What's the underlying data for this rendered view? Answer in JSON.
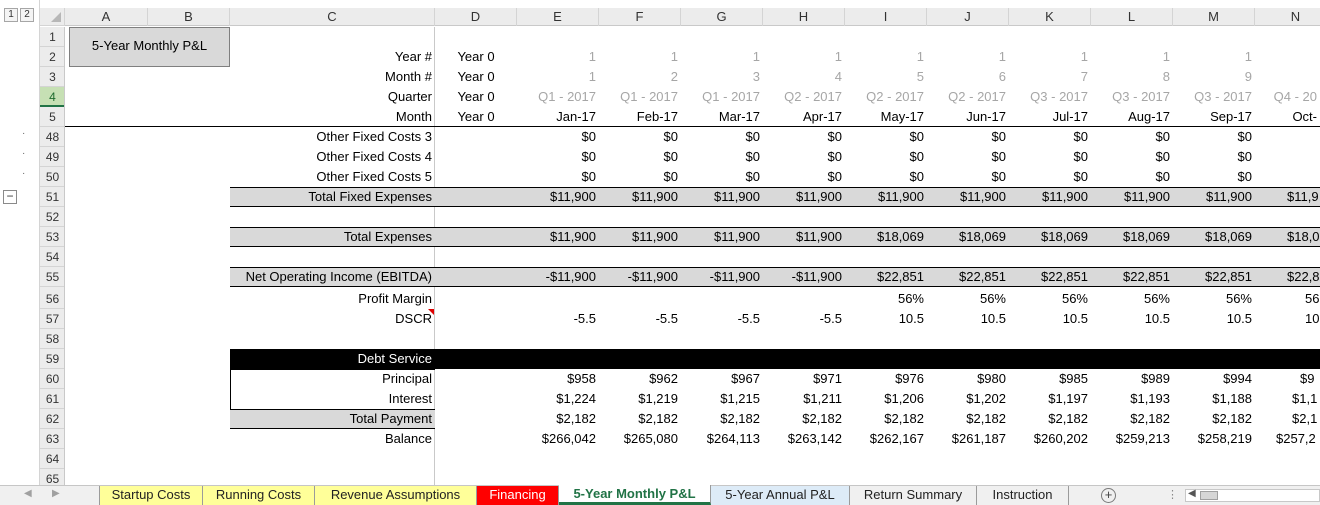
{
  "outline": {
    "levels": [
      "1",
      "2"
    ],
    "collapse_symbol": "−",
    "dot": "·"
  },
  "columns": [
    "A",
    "B",
    "C",
    "D",
    "E",
    "F",
    "G",
    "H",
    "I",
    "J",
    "K",
    "L",
    "M",
    "N"
  ],
  "rows": [
    "1",
    "2",
    "3",
    "4",
    "5",
    "48",
    "49",
    "50",
    "51",
    "52",
    "53",
    "54",
    "55",
    "56",
    "57",
    "58",
    "59",
    "60",
    "61",
    "62",
    "63",
    "64",
    "65"
  ],
  "title_box": "5-Year Monthly P&L",
  "header": {
    "year_label": "Year #",
    "month_label": "Month #",
    "quarter_label": "Quarter",
    "month_name_label": "Month",
    "d_value": "Year 0",
    "years": [
      "1",
      "1",
      "1",
      "1",
      "1",
      "1",
      "1",
      "1",
      "1",
      ""
    ],
    "month_nums": [
      "1",
      "2",
      "3",
      "4",
      "5",
      "6",
      "7",
      "8",
      "9",
      ""
    ],
    "quarters": [
      "Q1 - 2017",
      "Q1 - 2017",
      "Q1 - 2017",
      "Q2 - 2017",
      "Q2 - 2017",
      "Q2 - 2017",
      "Q3 - 2017",
      "Q3 - 2017",
      "Q3 - 2017",
      "Q4 - 20"
    ],
    "months": [
      "Jan-17",
      "Feb-17",
      "Mar-17",
      "Apr-17",
      "May-17",
      "Jun-17",
      "Jul-17",
      "Aug-17",
      "Sep-17",
      "Oct-"
    ]
  },
  "body": {
    "other_fixed_3": {
      "label": "Other Fixed Costs 3",
      "values": [
        "$0",
        "$0",
        "$0",
        "$0",
        "$0",
        "$0",
        "$0",
        "$0",
        "$0",
        ""
      ]
    },
    "other_fixed_4": {
      "label": "Other Fixed Costs 4",
      "values": [
        "$0",
        "$0",
        "$0",
        "$0",
        "$0",
        "$0",
        "$0",
        "$0",
        "$0",
        ""
      ]
    },
    "other_fixed_5": {
      "label": "Other Fixed Costs 5",
      "values": [
        "$0",
        "$0",
        "$0",
        "$0",
        "$0",
        "$0",
        "$0",
        "$0",
        "$0",
        ""
      ]
    },
    "total_fixed": {
      "label": "Total Fixed Expenses",
      "values": [
        "$11,900",
        "$11,900",
        "$11,900",
        "$11,900",
        "$11,900",
        "$11,900",
        "$11,900",
        "$11,900",
        "$11,900",
        "$11,9"
      ]
    },
    "total_expenses": {
      "label": "Total Expenses",
      "values": [
        "$11,900",
        "$11,900",
        "$11,900",
        "$11,900",
        "$18,069",
        "$18,069",
        "$18,069",
        "$18,069",
        "$18,069",
        "$18,0"
      ]
    },
    "noi": {
      "label": "Net Operating Income (EBITDA)",
      "values": [
        "-$11,900",
        "-$11,900",
        "-$11,900",
        "-$11,900",
        "$22,851",
        "$22,851",
        "$22,851",
        "$22,851",
        "$22,851",
        "$22,8"
      ]
    },
    "profit_margin": {
      "label": "Profit Margin",
      "values": [
        "",
        "",
        "",
        "",
        "56%",
        "56%",
        "56%",
        "56%",
        "56%",
        "56"
      ]
    },
    "dscr": {
      "label": "DSCR",
      "values": [
        "-5.5",
        "-5.5",
        "-5.5",
        "-5.5",
        "10.5",
        "10.5",
        "10.5",
        "10.5",
        "10.5",
        "10"
      ]
    },
    "debt_service": {
      "label": "Debt Service"
    },
    "principal": {
      "label": "Principal",
      "values": [
        "$958",
        "$962",
        "$967",
        "$971",
        "$976",
        "$980",
        "$985",
        "$989",
        "$994",
        "$9"
      ]
    },
    "interest": {
      "label": "Interest",
      "values": [
        "$1,224",
        "$1,219",
        "$1,215",
        "$1,211",
        "$1,206",
        "$1,202",
        "$1,197",
        "$1,193",
        "$1,188",
        "$1,1"
      ]
    },
    "total_payment": {
      "label": "Total Payment",
      "values": [
        "$2,182",
        "$2,182",
        "$2,182",
        "$2,182",
        "$2,182",
        "$2,182",
        "$2,182",
        "$2,182",
        "$2,182",
        "$2,1"
      ]
    },
    "balance": {
      "label": "Balance",
      "values": [
        "$266,042",
        "$265,080",
        "$264,113",
        "$263,142",
        "$262,167",
        "$261,187",
        "$260,202",
        "$259,213",
        "$258,219",
        "$257,2"
      ]
    }
  },
  "tabs": [
    {
      "label": "Startup Costs",
      "style": "yellow"
    },
    {
      "label": "Running Costs",
      "style": "yellow"
    },
    {
      "label": "Revenue Assumptions",
      "style": "yellow"
    },
    {
      "label": "Financing",
      "style": "red"
    },
    {
      "label": "5-Year Monthly P&L",
      "style": "active"
    },
    {
      "label": "5-Year Annual P&L",
      "style": "lightblue"
    },
    {
      "label": "Return Summary",
      "style": "plain"
    },
    {
      "label": "Instruction",
      "style": "plain"
    }
  ],
  "tab_controls": {
    "prev": "◀",
    "next": "▶",
    "add": "+",
    "more": "⋮",
    "scroll_left": "◀"
  },
  "colors": {
    "selected_row": "#c6e0b4",
    "accent": "#217346",
    "band_gray": "#d9d9d9",
    "tab_yellow": "#ffff99",
    "tab_red": "#ff0000",
    "tab_lightblue": "#ddebf7"
  }
}
